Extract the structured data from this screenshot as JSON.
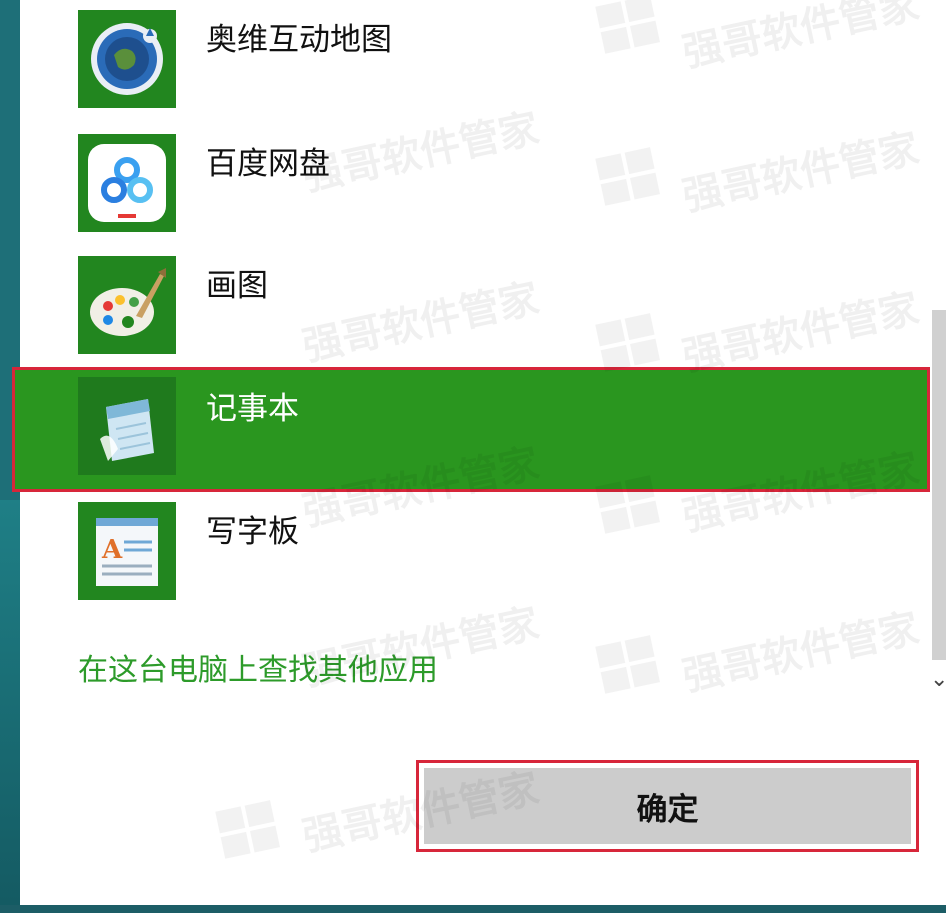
{
  "apps": [
    {
      "label": "奥维互动地图",
      "icon": "globe-map-icon",
      "selected": false
    },
    {
      "label": "百度网盘",
      "icon": "baidu-netdisk-icon",
      "selected": false
    },
    {
      "label": "画图",
      "icon": "paint-palette-icon",
      "selected": false
    },
    {
      "label": "记事本",
      "icon": "notepad-icon",
      "selected": true
    },
    {
      "label": "写字板",
      "icon": "wordpad-icon",
      "selected": false
    }
  ],
  "more_apps_link": "在这台电脑上查找其他应用",
  "ok_button": "确定",
  "watermark": "强哥软件管家",
  "colors": {
    "tile_green": "#22861f",
    "selected_green": "#2a961f",
    "link_green": "#2d9b2a",
    "highlight_red": "#d7263a",
    "button_gray": "#cccccc"
  }
}
